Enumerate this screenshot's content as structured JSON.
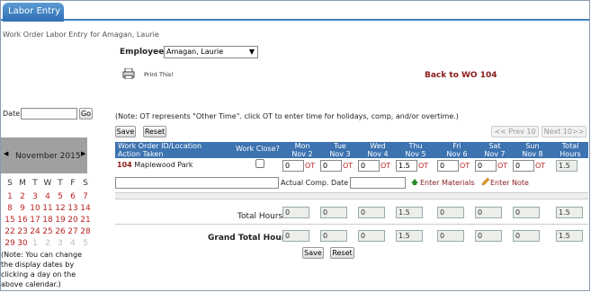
{
  "tab": {
    "label": "Labor Entry"
  },
  "page": {
    "subtitle": "Work Order Labor Entry for Amagan, Laurie"
  },
  "employee": {
    "label": "Employee",
    "value": "Amagan, Laurie"
  },
  "print": {
    "label": "Print This!"
  },
  "back_link": "Back to WO 104",
  "date": {
    "label": "Date",
    "value": "",
    "go": "Go"
  },
  "note_ot": "(Note: OT represents \"Other Time\". click OT to enter time for holidays, comp, and/or overtime.)",
  "actions": {
    "save": "Save",
    "reset": "Reset",
    "prev": "<< Prev 10",
    "next": "Next 10>>"
  },
  "table": {
    "h_wo": "Work Order ID/Location",
    "h_action": "Action Taken",
    "h_close": "Work Close?",
    "days": [
      {
        "name": "Mon",
        "date": "Nov 2"
      },
      {
        "name": "Tue",
        "date": "Nov 3"
      },
      {
        "name": "Wed",
        "date": "Nov 4"
      },
      {
        "name": "Thu",
        "date": "Nov 5"
      },
      {
        "name": "Fri",
        "date": "Nov 6"
      },
      {
        "name": "Sat",
        "date": "Nov 7"
      },
      {
        "name": "Sun",
        "date": "Nov 8"
      }
    ],
    "h_total": "Total",
    "h_hours": "Hours",
    "row": {
      "wo_id": "104",
      "location": "Maplewood Park",
      "hours": [
        "0",
        "0",
        "0",
        "1.5",
        "0",
        "0",
        "0"
      ],
      "ot": "OT",
      "total": "1.5",
      "action_value": ""
    },
    "comp_label": "Actual Comp. Date",
    "comp_value": "",
    "enter_materials": "Enter Materials",
    "enter_note": "Enter Note",
    "total_label": "Total Hours",
    "totals": [
      "0",
      "0",
      "0",
      "1.5",
      "0",
      "0",
      "0",
      "1.5"
    ],
    "grand_label": "Grand Total Hours",
    "grand": [
      "0",
      "0",
      "0",
      "1.5",
      "0",
      "0",
      "0",
      "1.5"
    ]
  },
  "calendar": {
    "month": "November 2015",
    "weekdays": [
      "S",
      "M",
      "T",
      "W",
      "T",
      "F",
      "S"
    ],
    "weeks": [
      [
        "1",
        "2",
        "3",
        "4",
        "5",
        "6",
        "7"
      ],
      [
        "8",
        "9",
        "10",
        "11",
        "12",
        "13",
        "14"
      ],
      [
        "15",
        "16",
        "17",
        "18",
        "19",
        "20",
        "21"
      ],
      [
        "22",
        "23",
        "24",
        "25",
        "26",
        "27",
        "28"
      ],
      [
        "29",
        "30",
        "1",
        "2",
        "3",
        "4",
        "5"
      ]
    ]
  },
  "calendar_note": "(Note: You can change the display dates by clicking a day on the above calendar.)"
}
